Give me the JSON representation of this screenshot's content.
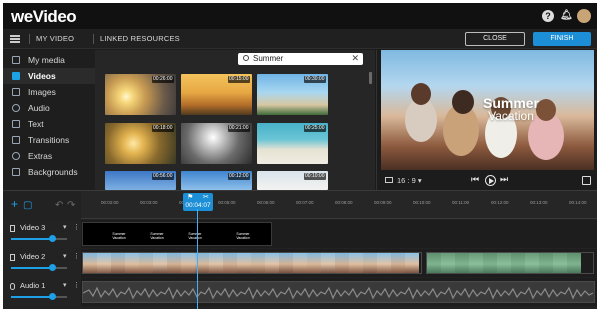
{
  "app": {
    "logo": "weVideo",
    "logo_dot": ""
  },
  "topbar": {
    "help_icon": "question-icon",
    "notifications_icon": "bell-icon",
    "avatar_color": "#c9a477"
  },
  "menubar": {
    "my_video": "MY VIDEO",
    "linked_resources": "LINKED RESOURCES",
    "close_label": "CLOSE",
    "finish_label": "FINISH",
    "finish_color": "#1c8fd6"
  },
  "sidebar": {
    "items": [
      {
        "label": "My media",
        "icon": "folder-icon",
        "active": false
      },
      {
        "label": "Videos",
        "icon": "video-icon",
        "active": true
      },
      {
        "label": "Images",
        "icon": "image-icon",
        "active": false
      },
      {
        "label": "Audio",
        "icon": "music-icon",
        "active": false
      },
      {
        "label": "Text",
        "icon": "text-icon",
        "active": false
      },
      {
        "label": "Transitions",
        "icon": "transition-icon",
        "active": false
      },
      {
        "label": "Extras",
        "icon": "extras-icon",
        "active": false
      },
      {
        "label": "Backgrounds",
        "icon": "backgrounds-icon",
        "active": false
      }
    ]
  },
  "library": {
    "search": {
      "value": "Summer",
      "clear": "✕"
    },
    "thumbs": [
      {
        "duration": "00:26:00"
      },
      {
        "duration": "00:15:00"
      },
      {
        "duration": "00:30:00"
      },
      {
        "duration": "00:18:00"
      },
      {
        "duration": "00:21:00"
      },
      {
        "duration": "00:25:00"
      },
      {
        "duration": "00:56:00"
      },
      {
        "duration": "00:12:00"
      },
      {
        "duration": "00:10:00"
      }
    ]
  },
  "preview": {
    "title": "Summer",
    "subtitle": "Vacation",
    "ratio": "16 : 9 ▾",
    "prev": "⏮",
    "next": "⏭"
  },
  "timeline": {
    "current_time": "00:04:07",
    "ticks": [
      "00:02:00",
      "00:03:00",
      "00:04:00",
      "00:05:00",
      "00:06:00",
      "00:07:00",
      "00:08:00",
      "00:09:00",
      "00:10:00",
      "00:11:00",
      "00:12:00",
      "00:13:00",
      "00:14:00"
    ],
    "tracks": [
      {
        "name": "Video 3",
        "volume": 0.75
      },
      {
        "name": "Video 2",
        "volume": 0.75
      },
      {
        "name": "Audio 1",
        "volume": 0.75
      }
    ],
    "title_captions": [
      "Summer Vacation",
      "Summer Vacation",
      "Summer Vacation",
      "Summer Vacation"
    ]
  }
}
